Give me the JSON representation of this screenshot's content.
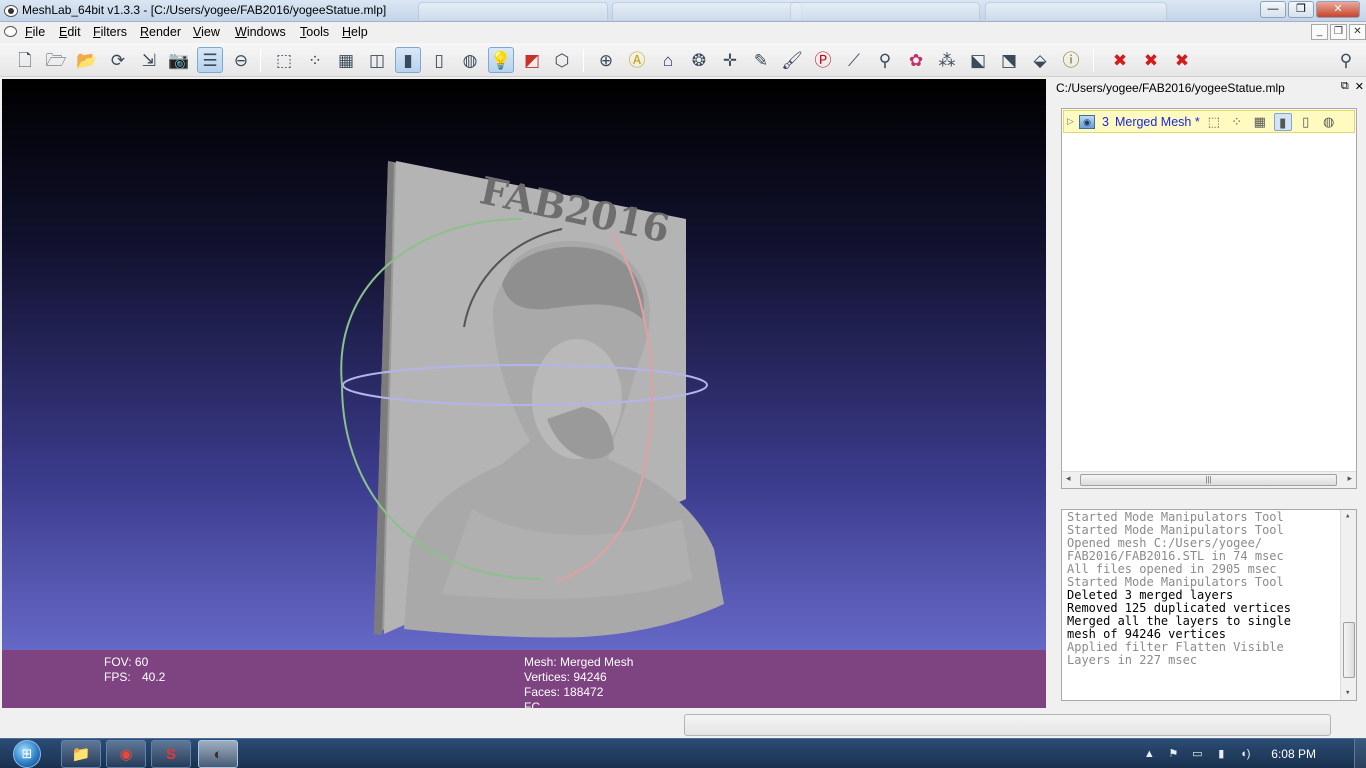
{
  "window": {
    "title": "MeshLab_64bit v1.3.3 - [C:/Users/yogee/FAB2016/yogeeStatue.mlp]",
    "controls": {
      "minimize": "—",
      "maximize": "❐",
      "close": "✕"
    }
  },
  "menu": {
    "items": [
      "File",
      "Edit",
      "Filters",
      "Render",
      "View",
      "Windows",
      "Tools",
      "Help"
    ],
    "mdi_controls": [
      "_",
      "❐",
      "✕"
    ]
  },
  "toolbar": {
    "icons": [
      {
        "name": "new-project-icon",
        "glyph": "🗋",
        "active": false
      },
      {
        "name": "open-project-icon",
        "glyph": "🗁",
        "active": false
      },
      {
        "name": "import-mesh-icon",
        "glyph": "📂",
        "active": false
      },
      {
        "name": "reload-icon",
        "glyph": "⟳",
        "active": false
      },
      {
        "name": "export-mesh-icon",
        "glyph": "⇲",
        "active": false
      },
      {
        "name": "snapshot-icon",
        "glyph": "📷",
        "active": false
      },
      {
        "name": "layers-icon",
        "glyph": "☰",
        "active": true
      },
      {
        "name": "plugins-icon",
        "glyph": "⊖",
        "active": false
      },
      {
        "name": "bounding-box-icon",
        "glyph": "⬚",
        "active": false
      },
      {
        "name": "points-icon",
        "glyph": "⁘",
        "active": false
      },
      {
        "name": "wireframe-icon",
        "glyph": "▦",
        "active": false
      },
      {
        "name": "hidden-lines-icon",
        "glyph": "◫",
        "active": false
      },
      {
        "name": "flat-lines-icon",
        "glyph": "▮",
        "active": true
      },
      {
        "name": "flat-icon",
        "glyph": "▯",
        "active": false
      },
      {
        "name": "smooth-icon",
        "glyph": "◍",
        "active": false
      },
      {
        "name": "light-icon",
        "glyph": "💡",
        "active": true
      },
      {
        "name": "backface-icon",
        "glyph": "◩",
        "active": false
      },
      {
        "name": "selection-icon",
        "glyph": "⬡",
        "active": false
      },
      {
        "name": "manipulators-icon",
        "glyph": "⊕",
        "active": false
      },
      {
        "name": "annotation-icon",
        "glyph": "Ⓐ",
        "active": false
      },
      {
        "name": "georeference-icon",
        "glyph": "⌂",
        "active": false
      },
      {
        "name": "texture-icon",
        "glyph": "❂",
        "active": false
      },
      {
        "name": "axes-icon",
        "glyph": "✛",
        "active": false
      },
      {
        "name": "vertex-paint-icon",
        "glyph": "✎",
        "active": false
      },
      {
        "name": "brush-icon",
        "glyph": "🖌",
        "active": false
      },
      {
        "name": "pick-points-icon",
        "glyph": "Ⓟ",
        "active": false
      },
      {
        "name": "measure-icon",
        "glyph": "⟋",
        "active": false
      },
      {
        "name": "align-icon",
        "glyph": "⚲",
        "active": false
      },
      {
        "name": "paint-icon",
        "glyph": "✿",
        "active": false
      },
      {
        "name": "reference-icon",
        "glyph": "⁂",
        "active": false
      },
      {
        "name": "select-faces-icon",
        "glyph": "⬕",
        "active": false
      },
      {
        "name": "select-vertices-icon",
        "glyph": "⬔",
        "active": false
      },
      {
        "name": "select-connected-icon",
        "glyph": "⬙",
        "active": false
      },
      {
        "name": "info-icon",
        "glyph": "ⓘ",
        "active": false
      },
      {
        "name": "delete-selected-icon",
        "glyph": "✖",
        "active": false
      },
      {
        "name": "delete-faces-icon",
        "glyph": "✖",
        "active": false
      },
      {
        "name": "delete-vertices-icon",
        "glyph": "✖",
        "active": false
      },
      {
        "name": "search-icon",
        "glyph": "⚲",
        "active": false
      }
    ]
  },
  "viewport": {
    "model_text": "FAB2016"
  },
  "info": {
    "fov_label": "FOV: 60",
    "fps_label": "FPS:",
    "fps_value": "40.2",
    "mesh": "Mesh: Merged Mesh",
    "vertices": "Vertices: 94246",
    "faces": "Faces: 188472",
    "fc": "FC"
  },
  "layer_panel": {
    "title": "C:/Users/yogee/FAB2016/yogeeStatue.mlp",
    "controls": {
      "float": "⧉",
      "close": "✕"
    },
    "layer": {
      "id": "3",
      "name": "Merged Mesh *",
      "expander": "▷",
      "thumb": "◉"
    },
    "layer_icons": [
      "⬚",
      "⁘",
      "▦",
      "▮",
      "▯",
      "◍"
    ],
    "scroll_left": "◂",
    "scroll_right": "▸",
    "scroll_grip": "|||"
  },
  "log": {
    "lines": [
      {
        "text": "Started Mode Manipulators Tool",
        "style": "gray"
      },
      {
        "text": "Started Mode Manipulators Tool",
        "style": "gray"
      },
      {
        "text": "Opened mesh C:/Users/yogee/",
        "style": "gray"
      },
      {
        "text": "FAB2016/FAB2016.STL in 74 msec",
        "style": "gray"
      },
      {
        "text": "All files opened in 2905 msec",
        "style": "gray"
      },
      {
        "text": "Started Mode Manipulators Tool",
        "style": "gray"
      },
      {
        "text": "Deleted 3 merged layers",
        "style": "black"
      },
      {
        "text": "Removed 125 duplicated vertices",
        "style": "black"
      },
      {
        "text": "Merged all the layers to single",
        "style": "black"
      },
      {
        "text": "mesh of 94246 vertices",
        "style": "black"
      },
      {
        "text": "Applied filter Flatten Visible",
        "style": "gray"
      },
      {
        "text": "Layers in 227 msec",
        "style": "gray"
      }
    ],
    "scroll_up": "▴",
    "scroll_down": "▾"
  },
  "taskbar": {
    "start_glyph": "⊞",
    "apps": [
      {
        "name": "explorer-taskbar-button",
        "glyph": "📁",
        "active": false
      },
      {
        "name": "chrome-taskbar-button",
        "glyph": "◉",
        "active": false
      },
      {
        "name": "solidworks-taskbar-button",
        "glyph": "S",
        "active": false
      },
      {
        "name": "meshlab-taskbar-button",
        "glyph": "◐",
        "active": true
      }
    ],
    "tray": [
      "▲",
      "⚑",
      "▭",
      "▮",
      "◖)"
    ],
    "clock": "6:08 PM"
  }
}
